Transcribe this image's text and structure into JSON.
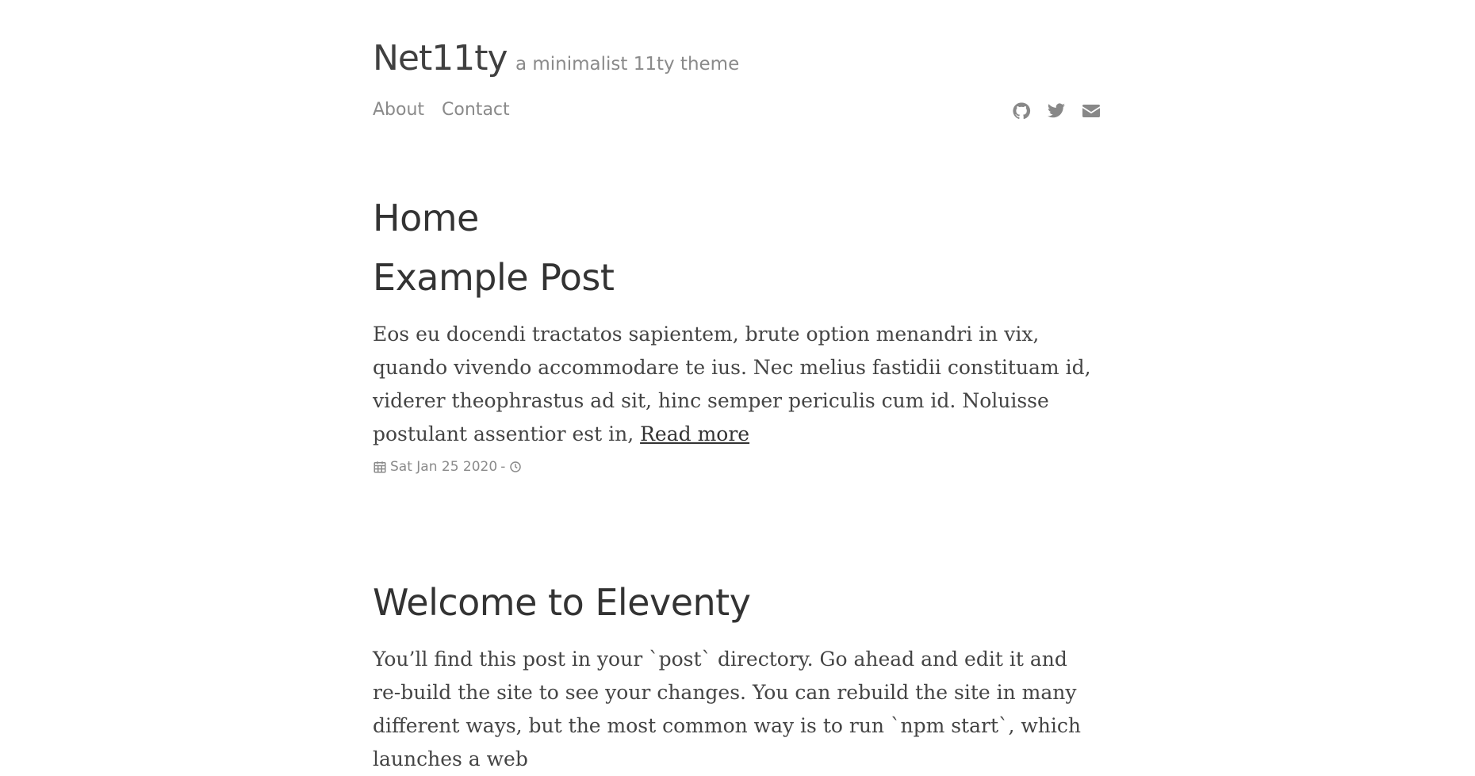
{
  "site": {
    "title": "Net11ty",
    "tagline": "a minimalist 11ty theme"
  },
  "nav": {
    "items": [
      {
        "label": "About"
      },
      {
        "label": "Contact"
      }
    ]
  },
  "socials": [
    {
      "icon": "github-icon"
    },
    {
      "icon": "twitter-icon"
    },
    {
      "icon": "email-icon"
    }
  ],
  "page": {
    "heading": "Home"
  },
  "posts": [
    {
      "title": "Example Post",
      "excerpt": "Eos eu docendi tractatos sapientem, brute option menandri in vix, quando vivendo accommodare te ius. Nec melius fastidii constituam id, viderer theophrastus ad sit, hinc semper periculis cum id. Noluisse postulant assentior est in, ",
      "read_more": "Read more",
      "date": "Sat Jan 25 2020",
      "separator": "-"
    },
    {
      "title": "Welcome to Eleventy",
      "excerpt": "You’ll find this post in your `post` directory. Go ahead and edit it and re-build the site to see your changes. You can rebuild the site in many different ways, but the most common way is to run `npm start`, which launches a web"
    }
  ],
  "colors": {
    "text": "#333333",
    "muted": "#8a8a8a",
    "background": "#ffffff"
  }
}
